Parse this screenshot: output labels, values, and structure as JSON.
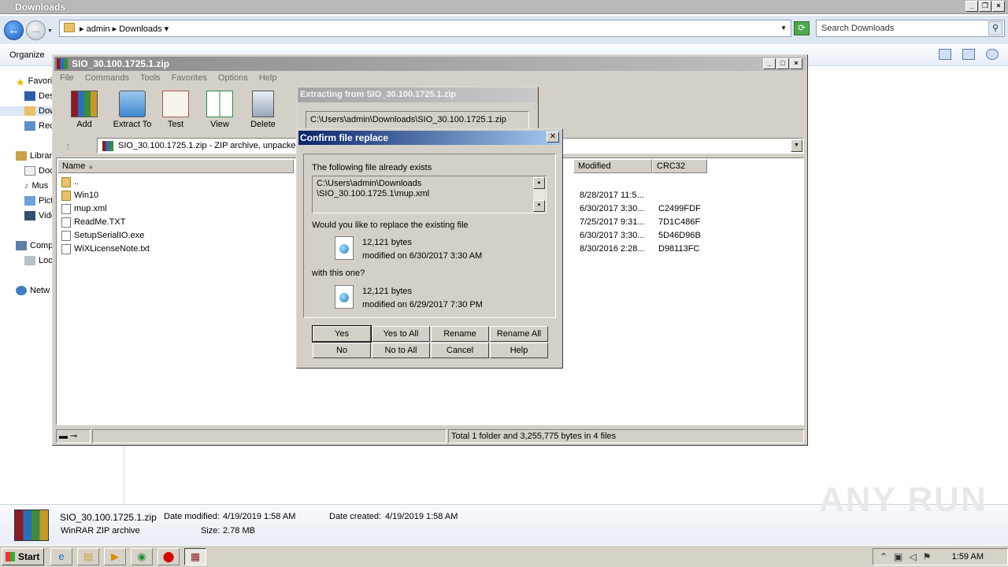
{
  "explorer": {
    "title": "Downloads",
    "breadcrumb": [
      "admin",
      "Downloads"
    ],
    "search_placeholder": "Search Downloads",
    "organize_label": "Organize",
    "nav": {
      "favorites": "Favori",
      "desktop": "Des",
      "downloads": "Dow",
      "recent": "Rec",
      "libraries": "Librar",
      "documents": "Doc",
      "music": "Mus",
      "pictures": "Pict",
      "videos": "Vide",
      "computer": "Comp",
      "local_disk": "Loc",
      "network": "Netw"
    },
    "details": {
      "file_name": "SIO_30.100.1725.1.zip",
      "date_modified_label": "Date modified:",
      "date_modified": "4/19/2019 1:58 AM",
      "date_created_label": "Date created:",
      "date_created": "4/19/2019 1:58 AM",
      "file_type": "WinRAR ZIP archive",
      "size_label": "Size:",
      "size": "2.78 MB"
    }
  },
  "winrar": {
    "title": "SIO_30.100.1725.1.zip",
    "menu": [
      "File",
      "Commands",
      "Tools",
      "Favorites",
      "Options",
      "Help"
    ],
    "toolbar": [
      {
        "label": "Add",
        "icon": "add-archive-icon"
      },
      {
        "label": "Extract To",
        "icon": "extract-folder-icon"
      },
      {
        "label": "Test",
        "icon": "test-clipboard-icon"
      },
      {
        "label": "View",
        "icon": "view-book-icon"
      },
      {
        "label": "Delete",
        "icon": "trash-icon"
      }
    ],
    "path": "SIO_30.100.1725.1.zip - ZIP archive, unpacked",
    "columns": {
      "name": "Name",
      "modified": "Modified",
      "crc": "CRC32"
    },
    "files": [
      {
        "name": "..",
        "modified": "",
        "crc": "",
        "type": "folder"
      },
      {
        "name": "Win10",
        "modified": "8/28/2017 11:5...",
        "crc": "",
        "type": "folder"
      },
      {
        "name": "mup.xml",
        "modified": "6/30/2017 3:30...",
        "crc": "C2499FDF",
        "type": "file"
      },
      {
        "name": "ReadMe.TXT",
        "modified": "7/25/2017 9:31...",
        "crc": "7D1C486F",
        "type": "file"
      },
      {
        "name": "SetupSerialIO.exe",
        "modified": "6/30/2017 3:30...",
        "crc": "5D46D96B",
        "type": "file"
      },
      {
        "name": "WiXLicenseNote.txt",
        "modified": "8/30/2016 2:28...",
        "crc": "D98113FC",
        "type": "file"
      }
    ],
    "status": "Total 1 folder and 3,255,775 bytes in 4 files"
  },
  "extracting": {
    "title": "Extracting from SIO_30.100.1725.1.zip",
    "path": "C:\\Users\\admin\\Downloads\\SIO_30.100.1725.1.zip"
  },
  "confirm": {
    "title": "Confirm file replace",
    "exists_label": "The following file already exists",
    "existing_path_line1": "C:\\Users\\admin\\Downloads",
    "existing_path_line2": "\\SIO_30.100.1725.1\\mup.xml",
    "replace_question": "Would you like to replace the existing file",
    "existing_size": "12,121 bytes",
    "existing_modified": "modified on 6/30/2017 3:30 AM",
    "with_label": "with this one?",
    "new_size": "12,121 bytes",
    "new_modified": "modified on 6/29/2017 7:30 PM",
    "buttons": [
      "Yes",
      "Yes to All",
      "Rename",
      "Rename All",
      "No",
      "No to All",
      "Cancel",
      "Help"
    ]
  },
  "taskbar": {
    "start_label": "Start",
    "clock": "1:59 AM"
  },
  "watermark": "ANY RUN"
}
